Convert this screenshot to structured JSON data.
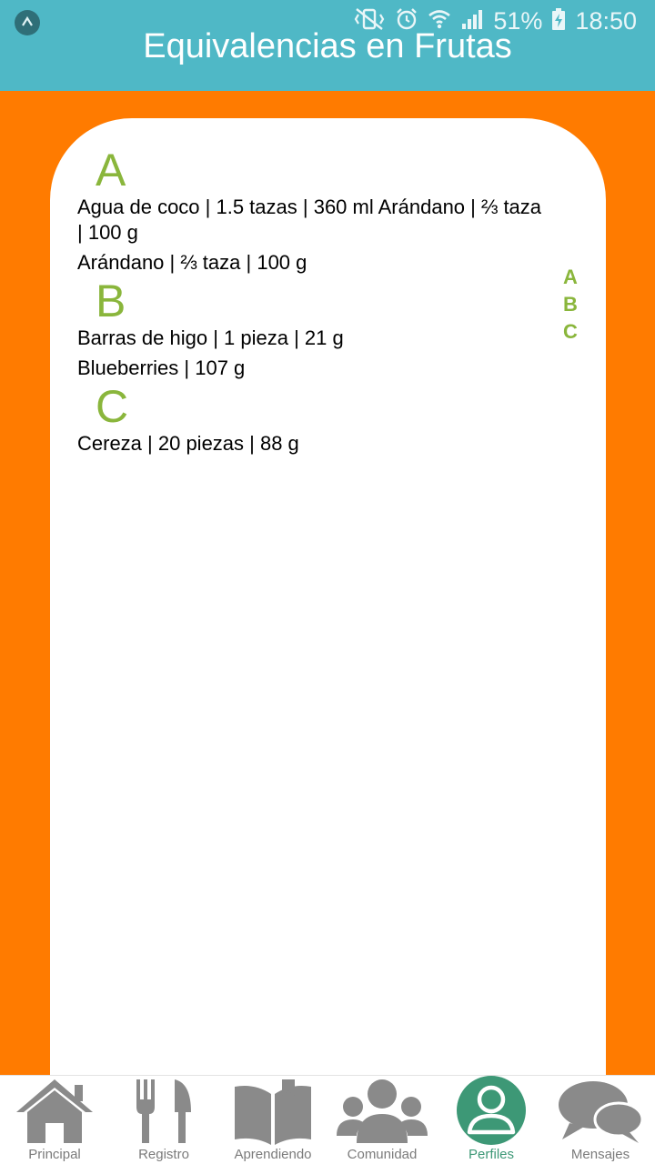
{
  "status_bar": {
    "battery": "51%",
    "time": "18:50"
  },
  "header": {
    "title": "Equivalencias en Frutas"
  },
  "sections": [
    {
      "letter": "A",
      "entries": [
        "Agua de coco | 1.5 tazas | 360 ml Arándano | ⅔ taza | 100 g",
        "Arándano | ⅔ taza | 100 g"
      ]
    },
    {
      "letter": "B",
      "entries": [
        "Barras de higo | 1 pieza | 21 g",
        "Blueberries | 107 g"
      ]
    },
    {
      "letter": "C",
      "entries": [
        "Cereza | 20 piezas | 88 g"
      ]
    }
  ],
  "index": [
    "A",
    "B",
    "C"
  ],
  "nav": [
    {
      "label": "Principal",
      "icon": "home-icon"
    },
    {
      "label": "Registro",
      "icon": "fork-knife-icon"
    },
    {
      "label": "Aprendiendo",
      "icon": "book-icon"
    },
    {
      "label": "Comunidad",
      "icon": "group-icon"
    },
    {
      "label": "Perfiles",
      "icon": "profile-icon",
      "active": true
    },
    {
      "label": "Mensajes",
      "icon": "chat-icon"
    }
  ],
  "colors": {
    "header": "#4fb8c6",
    "background": "#ff7b00",
    "accent_green": "#8ab63c",
    "active_nav": "#3d9876",
    "icon_gray": "#8a8a8a"
  }
}
